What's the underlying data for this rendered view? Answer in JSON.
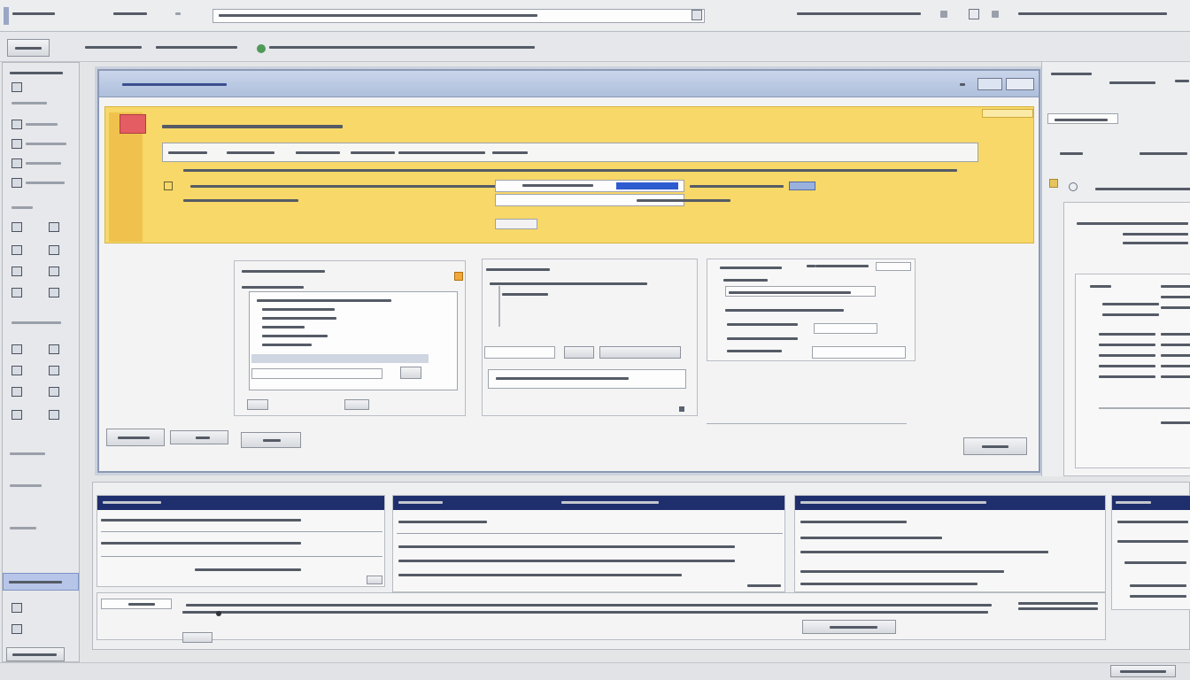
{
  "menubar": {
    "items": []
  },
  "toolbar": {},
  "window": {
    "title": ""
  },
  "banner": {},
  "dialogs": [],
  "bottom": {
    "panels": []
  },
  "right_panel": {},
  "status": {},
  "colors": {
    "banner": "#f7d868",
    "panel_header": "#1f2f6e",
    "title_bar": "#aebfdc",
    "accent_flag": "#e35d62",
    "progress_fill": "#2d5bd0"
  },
  "icons": [
    "document-icon",
    "folder-icon",
    "grid-icon",
    "list-icon",
    "image-icon",
    "gear-icon",
    "close-icon",
    "maximize-icon",
    "minimize-icon",
    "search-icon",
    "chevron-down-icon",
    "warning-icon"
  ]
}
